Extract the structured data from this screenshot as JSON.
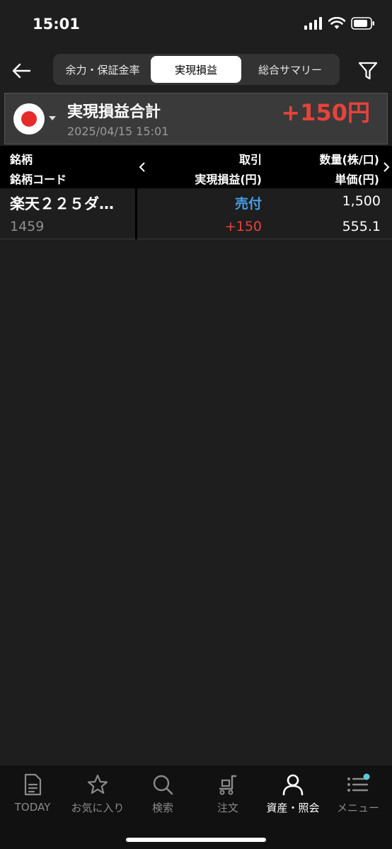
{
  "status_bar": {
    "time": "15:01"
  },
  "nav": {
    "tabs": [
      {
        "label": "余力・保証金率",
        "active": false
      },
      {
        "label": "実現損益",
        "active": true
      },
      {
        "label": "総合サマリー",
        "active": false
      }
    ]
  },
  "summary": {
    "title": "実現損益合計",
    "date": "2025/04/15 15:01",
    "total": "+150円"
  },
  "table": {
    "headers": {
      "col1_top": "銘柄",
      "col1_bottom": "銘柄コード",
      "col2_top": "取引",
      "col2_bottom": "実現損益(円)",
      "col3_top": "数量(株/口)",
      "col3_bottom": "単価(円)"
    },
    "rows": [
      {
        "name": "楽天２２５ダ…",
        "code": "1459",
        "trade": "売付",
        "pnl": "+150",
        "quantity": "1,500",
        "price": "555.1"
      }
    ]
  },
  "tab_bar": {
    "items": [
      {
        "label": "TODAY",
        "icon": "news-icon",
        "active": false
      },
      {
        "label": "お気に入り",
        "icon": "star-icon",
        "active": false
      },
      {
        "label": "検索",
        "icon": "search-icon",
        "active": false
      },
      {
        "label": "注文",
        "icon": "cart-icon",
        "active": false
      },
      {
        "label": "資産・照会",
        "icon": "person-icon",
        "active": true
      },
      {
        "label": "メニュー",
        "icon": "menu-icon",
        "active": false
      }
    ]
  },
  "colors": {
    "profit": "#e8423a",
    "sell": "#4a9ee8",
    "background": "#1e1e1e",
    "notification_dot": "#5bc8d8"
  }
}
